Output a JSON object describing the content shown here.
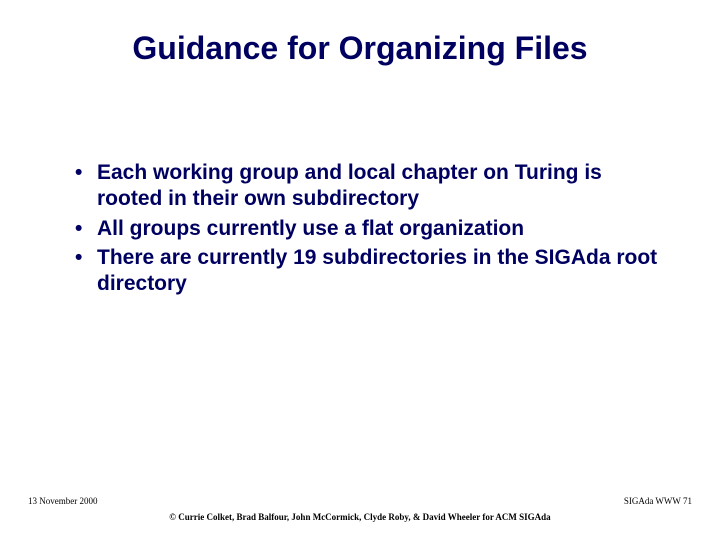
{
  "title": "Guidance for Organizing Files",
  "bullets": [
    "Each working group and local chapter on Turing is rooted in their own subdirectory",
    "All groups currently use a flat organization",
    "There are currently 19 subdirectories in the SIGAda root directory"
  ],
  "footer": {
    "date": "13 November 2000",
    "page_label": "SIGAda WWW 71",
    "copyright": "© Currie Colket, Brad Balfour, John McCormick, Clyde Roby, & David Wheeler for ACM SIGAda"
  }
}
